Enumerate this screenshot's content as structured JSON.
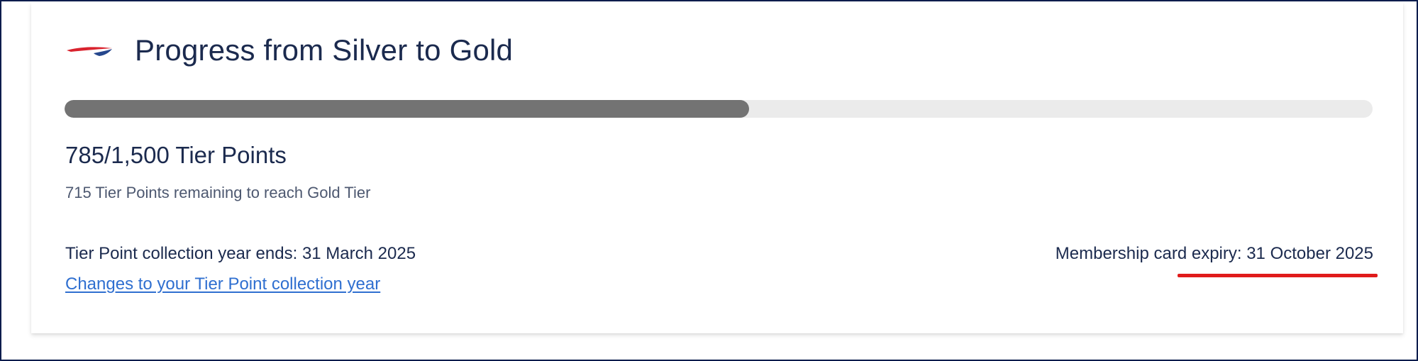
{
  "header": {
    "logo_icon": "speedmarque-logo-icon",
    "title": "Progress from Silver to Gold"
  },
  "progress": {
    "current": 785,
    "target": 1500,
    "fraction": 0.5233,
    "points_text": "785/1,500 Tier Points",
    "remaining_text": "715 Tier Points remaining to reach Gold Tier",
    "fill_color": "#737373",
    "track_color": "#ebebeb"
  },
  "collection": {
    "ends_text": "Tier Point collection year ends: 31 March 2025",
    "changes_link": "Changes to your Tier Point collection year"
  },
  "membership": {
    "expiry_text": "Membership card expiry: 31 October 2025"
  },
  "colors": {
    "title": "#1b2a4e",
    "link": "#2f6fd0",
    "highlight": "#e01b1b",
    "frame_border": "#0b1c4d"
  }
}
